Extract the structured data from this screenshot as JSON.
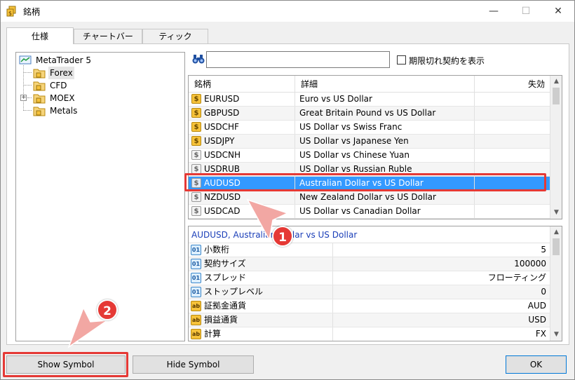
{
  "window": {
    "title": "銘柄",
    "icon": "symbols-dialog-icon",
    "controls": {
      "minimize": "—",
      "maximize": "☐",
      "close": "✕"
    }
  },
  "tabs": [
    {
      "label": "仕様",
      "active": true
    },
    {
      "label": "チャートバー",
      "active": false
    },
    {
      "label": "ティック",
      "active": false
    }
  ],
  "tree": {
    "root": "MetaTrader 5",
    "items": [
      {
        "label": "Forex",
        "selected": true
      },
      {
        "label": "CFD",
        "selected": false
      },
      {
        "label": "MOEX",
        "selected": false,
        "expandable": true
      },
      {
        "label": "Metals",
        "selected": false
      }
    ]
  },
  "search": {
    "value": "",
    "placeholder": ""
  },
  "show_expired": {
    "label": "期限切れ契約を表示",
    "checked": false
  },
  "symbols_table": {
    "columns": [
      "銘柄",
      "詳細",
      "失効"
    ],
    "rows": [
      {
        "symbol": "EURUSD",
        "description": "Euro vs US Dollar",
        "expiry": "",
        "active": true
      },
      {
        "symbol": "GBPUSD",
        "description": "Great Britain Pound vs US Dollar",
        "expiry": "",
        "active": true
      },
      {
        "symbol": "USDCHF",
        "description": "US Dollar vs Swiss Franc",
        "expiry": "",
        "active": true
      },
      {
        "symbol": "USDJPY",
        "description": "US Dollar vs Japanese Yen",
        "expiry": "",
        "active": true
      },
      {
        "symbol": "USDCNH",
        "description": "US Dollar vs Chinese Yuan",
        "expiry": "",
        "active": false
      },
      {
        "symbol": "USDRUB",
        "description": "US Dollar vs Russian Ruble",
        "expiry": "",
        "active": false
      },
      {
        "symbol": "AUDUSD",
        "description": "Australian Dollar vs US Dollar",
        "expiry": "",
        "active": false,
        "selected": true
      },
      {
        "symbol": "NZDUSD",
        "description": "New Zealand Dollar vs US Dollar",
        "expiry": "",
        "active": false
      },
      {
        "symbol": "USDCAD",
        "description": "US Dollar vs Canadian Dollar",
        "expiry": "",
        "active": false
      }
    ]
  },
  "properties": {
    "title": "AUDUSD, Australian Dollar vs US Dollar",
    "rows": [
      {
        "icon": "01",
        "kind": "num",
        "key": "小数桁",
        "value": "5"
      },
      {
        "icon": "01",
        "kind": "num",
        "key": "契約サイズ",
        "value": "100000"
      },
      {
        "icon": "01",
        "kind": "num",
        "key": "スプレッド",
        "value": "フローティング"
      },
      {
        "icon": "01",
        "kind": "num",
        "key": "ストップレベル",
        "value": "0"
      },
      {
        "icon": "ab",
        "kind": "str",
        "key": "証拠金通貨",
        "value": "AUD"
      },
      {
        "icon": "ab",
        "kind": "str",
        "key": "損益通貨",
        "value": "USD"
      },
      {
        "icon": "ab",
        "kind": "str",
        "key": "計算",
        "value": "FX"
      }
    ]
  },
  "buttons": {
    "show": "Show Symbol",
    "hide": "Hide Symbol",
    "ok": "OK"
  },
  "annotations": {
    "marker1": "1",
    "marker2": "2",
    "highlight_color": "#e53935"
  },
  "colors": {
    "selection": "#3399ff",
    "active_symbol_icon": "#f6c23a",
    "properties_title": "#1a3eb8"
  }
}
